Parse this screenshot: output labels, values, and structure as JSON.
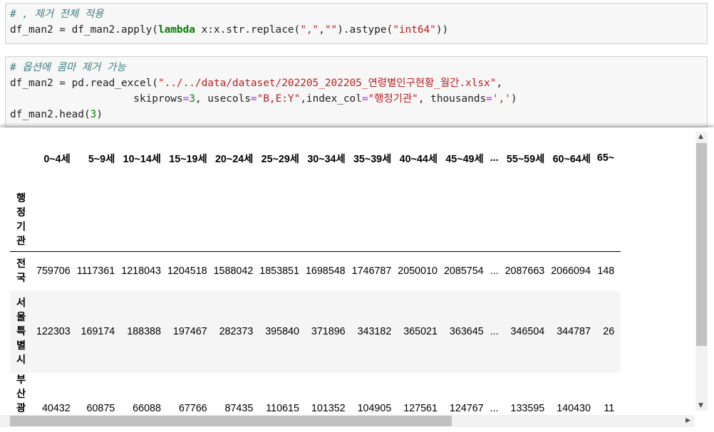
{
  "cell1": {
    "comment": "# , 제거 전체 적용",
    "line2_prefix": "df_man2 = df_man2.apply(",
    "line2_kw": "lambda",
    "line2_mid": " x:x.str.replace(",
    "line2_s1": "\",\"",
    "line2_c": ",",
    "line2_s2": "\"\"",
    "line2_mid2": ").astype(",
    "line2_s3": "\"int64\"",
    "line2_end": "))"
  },
  "cell2": {
    "comment": "# 옵션에 콤마 제거 가능",
    "l2_prefix": "df_man2 = pd.read_excel(",
    "l2_path": "\"../../data/dataset/202205_202205_연령별인구현황_월간.xlsx\"",
    "l2_end": ",",
    "l3_indent": "                    ",
    "l3_a": "skiprows",
    "l3_b": "3",
    "l3_c": ", usecols",
    "l3_d": "\"B,E:Y\"",
    "l3_e": ",index_col",
    "l3_f": "\"행정기관\"",
    "l3_g": ", thousands",
    "l3_h": "','",
    "l3_i": ")",
    "l4_a": "df_man2.head(",
    "l4_b": "3",
    "l4_c": ")"
  },
  "table": {
    "columns": [
      "0~4세",
      "5~9세",
      "10~14세",
      "15~19세",
      "20~24세",
      "25~29세",
      "30~34세",
      "35~39세",
      "40~44세",
      "45~49세",
      "...",
      "55~59세",
      "60~64세",
      "65~"
    ],
    "index_name": "행정기관",
    "rows": [
      {
        "label": "전국",
        "values": [
          "759706",
          "1117361",
          "1218043",
          "1204518",
          "1588042",
          "1853851",
          "1698548",
          "1746787",
          "2050010",
          "2085754",
          "...",
          "2087663",
          "2066094",
          "148"
        ]
      },
      {
        "label": "서울특별시",
        "values": [
          "122303",
          "169174",
          "188388",
          "197467",
          "282373",
          "395840",
          "371896",
          "343182",
          "365021",
          "363645",
          "...",
          "346504",
          "344787",
          "26"
        ]
      },
      {
        "label": "부산광역시",
        "values": [
          "40432",
          "60875",
          "66088",
          "67766",
          "87435",
          "110615",
          "101352",
          "104905",
          "127561",
          "124767",
          "...",
          "133595",
          "140430",
          "11"
        ]
      }
    ]
  },
  "colors": {
    "comment": "#408080",
    "string": "#ba2121",
    "keyword": "#008000",
    "number": "#008800",
    "operator": "#aa22ff"
  }
}
